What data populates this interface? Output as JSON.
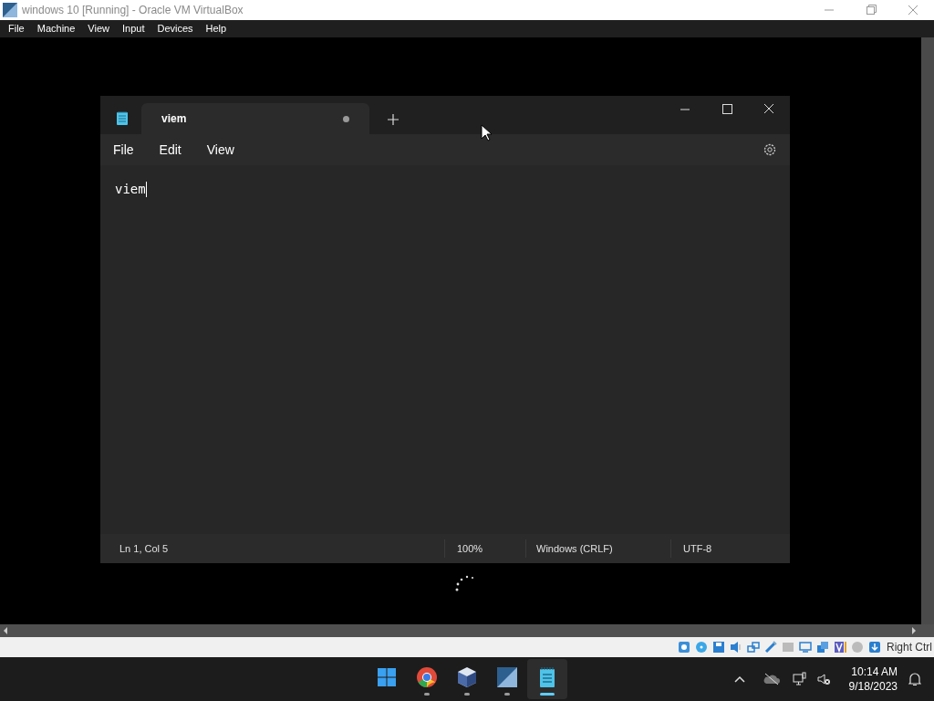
{
  "host_window": {
    "title": "windows 10 [Running] - Oracle VM VirtualBox"
  },
  "host_menu": [
    "File",
    "Machine",
    "View",
    "Input",
    "Devices",
    "Help"
  ],
  "notepad": {
    "tab": {
      "title": "viem",
      "selected": true,
      "modified": true
    },
    "menu": [
      "File",
      "Edit",
      "View"
    ],
    "text": "viem",
    "status_bar": [
      "Ln 1, Col 5",
      "100%",
      "Windows (CRLF)",
      "UTF-8"
    ]
  },
  "host_status": {
    "host_key": "Right Ctrl"
  },
  "taskbar": {
    "apps": [
      {
        "kind": "start",
        "selected": false
      },
      {
        "kind": "browser",
        "selected": false
      },
      {
        "kind": "cube",
        "selected": false
      },
      {
        "kind": "vbox",
        "selected": false
      },
      {
        "kind": "notepad",
        "selected": true
      }
    ],
    "time": "10:14 AM",
    "date": "9/18/2023"
  }
}
